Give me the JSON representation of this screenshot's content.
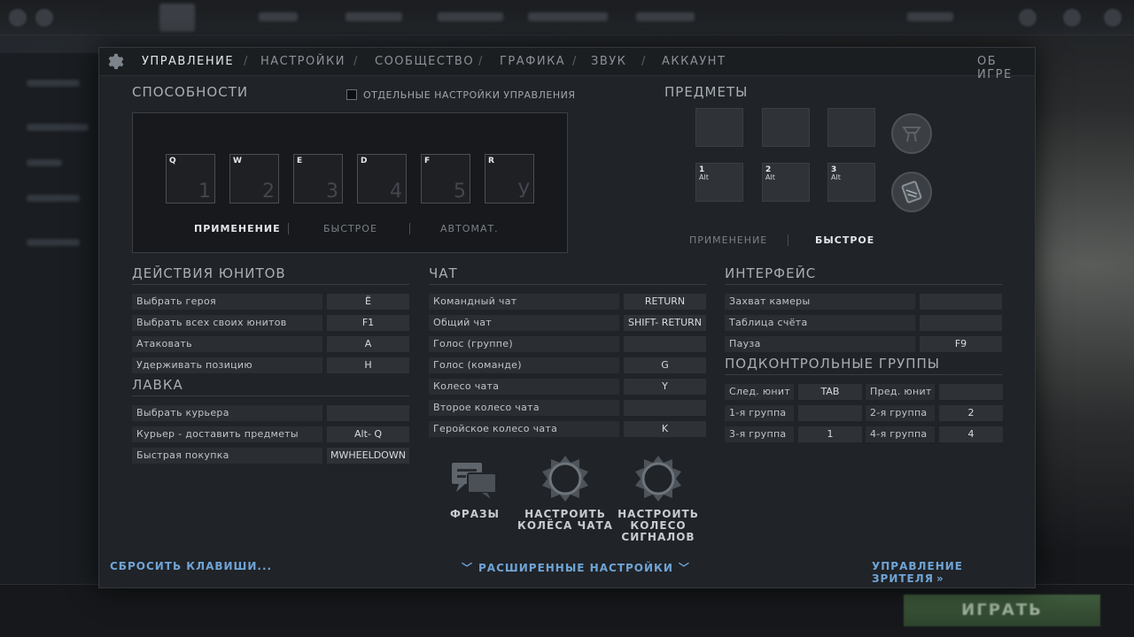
{
  "tabs": {
    "controls": "УПРАВЛЕНИЕ",
    "settings": "НАСТРОЙКИ",
    "community": "СООБЩЕСТВО",
    "graphics": "ГРАФИКА",
    "sound": "ЗВУК",
    "account": "АККАУНТ",
    "about": "ОБ ИГРЕ"
  },
  "abilities": {
    "title": "СПОСОБНОСТИ",
    "separate_settings_label": "ОТДЕЛЬНЫЕ НАСТРОЙКИ УПРАВЛЕНИЯ",
    "separate_settings_checked": false,
    "slots": [
      {
        "key": "Q",
        "num": "1"
      },
      {
        "key": "W",
        "num": "2"
      },
      {
        "key": "E",
        "num": "3"
      },
      {
        "key": "D",
        "num": "4"
      },
      {
        "key": "F",
        "num": "5"
      },
      {
        "key": "R",
        "num": "У"
      }
    ],
    "modes": [
      "ПРИМЕНЕНИЕ",
      "БЫСТРОЕ",
      "АВТОМАТ."
    ],
    "active_mode": "ПРИМЕНЕНИЕ"
  },
  "items": {
    "title": "ПРЕДМЕТЫ",
    "slots_top": [
      {
        "key": ""
      },
      {
        "key": ""
      },
      {
        "key": ""
      }
    ],
    "slots_bottom": [
      {
        "key": "1",
        "mod": "Alt"
      },
      {
        "key": "2",
        "mod": "Alt"
      },
      {
        "key": "3",
        "mod": "Alt"
      }
    ],
    "modes": [
      "ПРИМЕНЕНИЕ",
      "БЫСТРОЕ"
    ],
    "active_mode": "БЫСТРОЕ"
  },
  "unit_actions": {
    "title": "ДЕЙСТВИЯ ЮНИТОВ",
    "rows": [
      {
        "label": "Выбрать героя",
        "key": "Ё"
      },
      {
        "label": "Выбрать всех своих юнитов",
        "key": "F1"
      },
      {
        "label": "Атаковать",
        "key": "A"
      },
      {
        "label": "Удерживать позицию",
        "key": "H"
      }
    ]
  },
  "shop": {
    "title": "ЛАВКА",
    "rows": [
      {
        "label": "Выбрать курьера",
        "key": ""
      },
      {
        "label": "Курьер - доставить предметы",
        "key": "Alt- Q"
      },
      {
        "label": "Быстрая покупка",
        "key": "MWHEELDOWN"
      }
    ]
  },
  "chat": {
    "title": "ЧАТ",
    "rows": [
      {
        "label": "Командный чат",
        "key": "RETURN"
      },
      {
        "label": "Общий чат",
        "key": "SHIFT- RETURN"
      },
      {
        "label": "Голос (группе)",
        "key": ""
      },
      {
        "label": "Голос (команде)",
        "key": "G"
      },
      {
        "label": "Колесо чата",
        "key": "Y"
      },
      {
        "label": "Второе колесо чата",
        "key": ""
      },
      {
        "label": "Геройское колесо чата",
        "key": "K"
      }
    ],
    "buttons": {
      "phrases": "ФРАЗЫ",
      "chat_wheels_l1": "НАСТРОИТЬ",
      "chat_wheels_l2": "КОЛЁСА ЧАТА",
      "signal_wheel_l1": "НАСТРОИТЬ",
      "signal_wheel_l2": "КОЛЕСО",
      "signal_wheel_l3": "СИГНАЛОВ"
    }
  },
  "interface": {
    "title": "ИНТЕРФЕЙС",
    "rows": [
      {
        "label": "Захват камеры",
        "key": ""
      },
      {
        "label": "Таблица счёта",
        "key": ""
      },
      {
        "label": "Пауза",
        "key": "F9"
      }
    ]
  },
  "control_groups": {
    "title": "ПОДКОНТРОЛЬНЫЕ ГРУППЫ",
    "rows": [
      {
        "l1": "След. юнит",
        "k1": "TAB",
        "l2": "Пред. юнит",
        "k2": ""
      },
      {
        "l1": "1-я группа",
        "k1": "",
        "l2": "2-я группа",
        "k2": "2"
      },
      {
        "l1": "3-я группа",
        "k1": "1",
        "l2": "4-я группа",
        "k2": "4"
      }
    ]
  },
  "footer": {
    "reset": "СБРОСИТЬ КЛАВИШИ...",
    "advanced": "РАСШИРЕННЫЕ НАСТРОЙКИ",
    "spectator": "УПРАВЛЕНИЕ ЗРИТЕЛЯ"
  },
  "background": {
    "play_button": "ИГРАТЬ"
  },
  "colors": {
    "accent_link": "#6fa4d6",
    "panel_bg": "#202327"
  }
}
